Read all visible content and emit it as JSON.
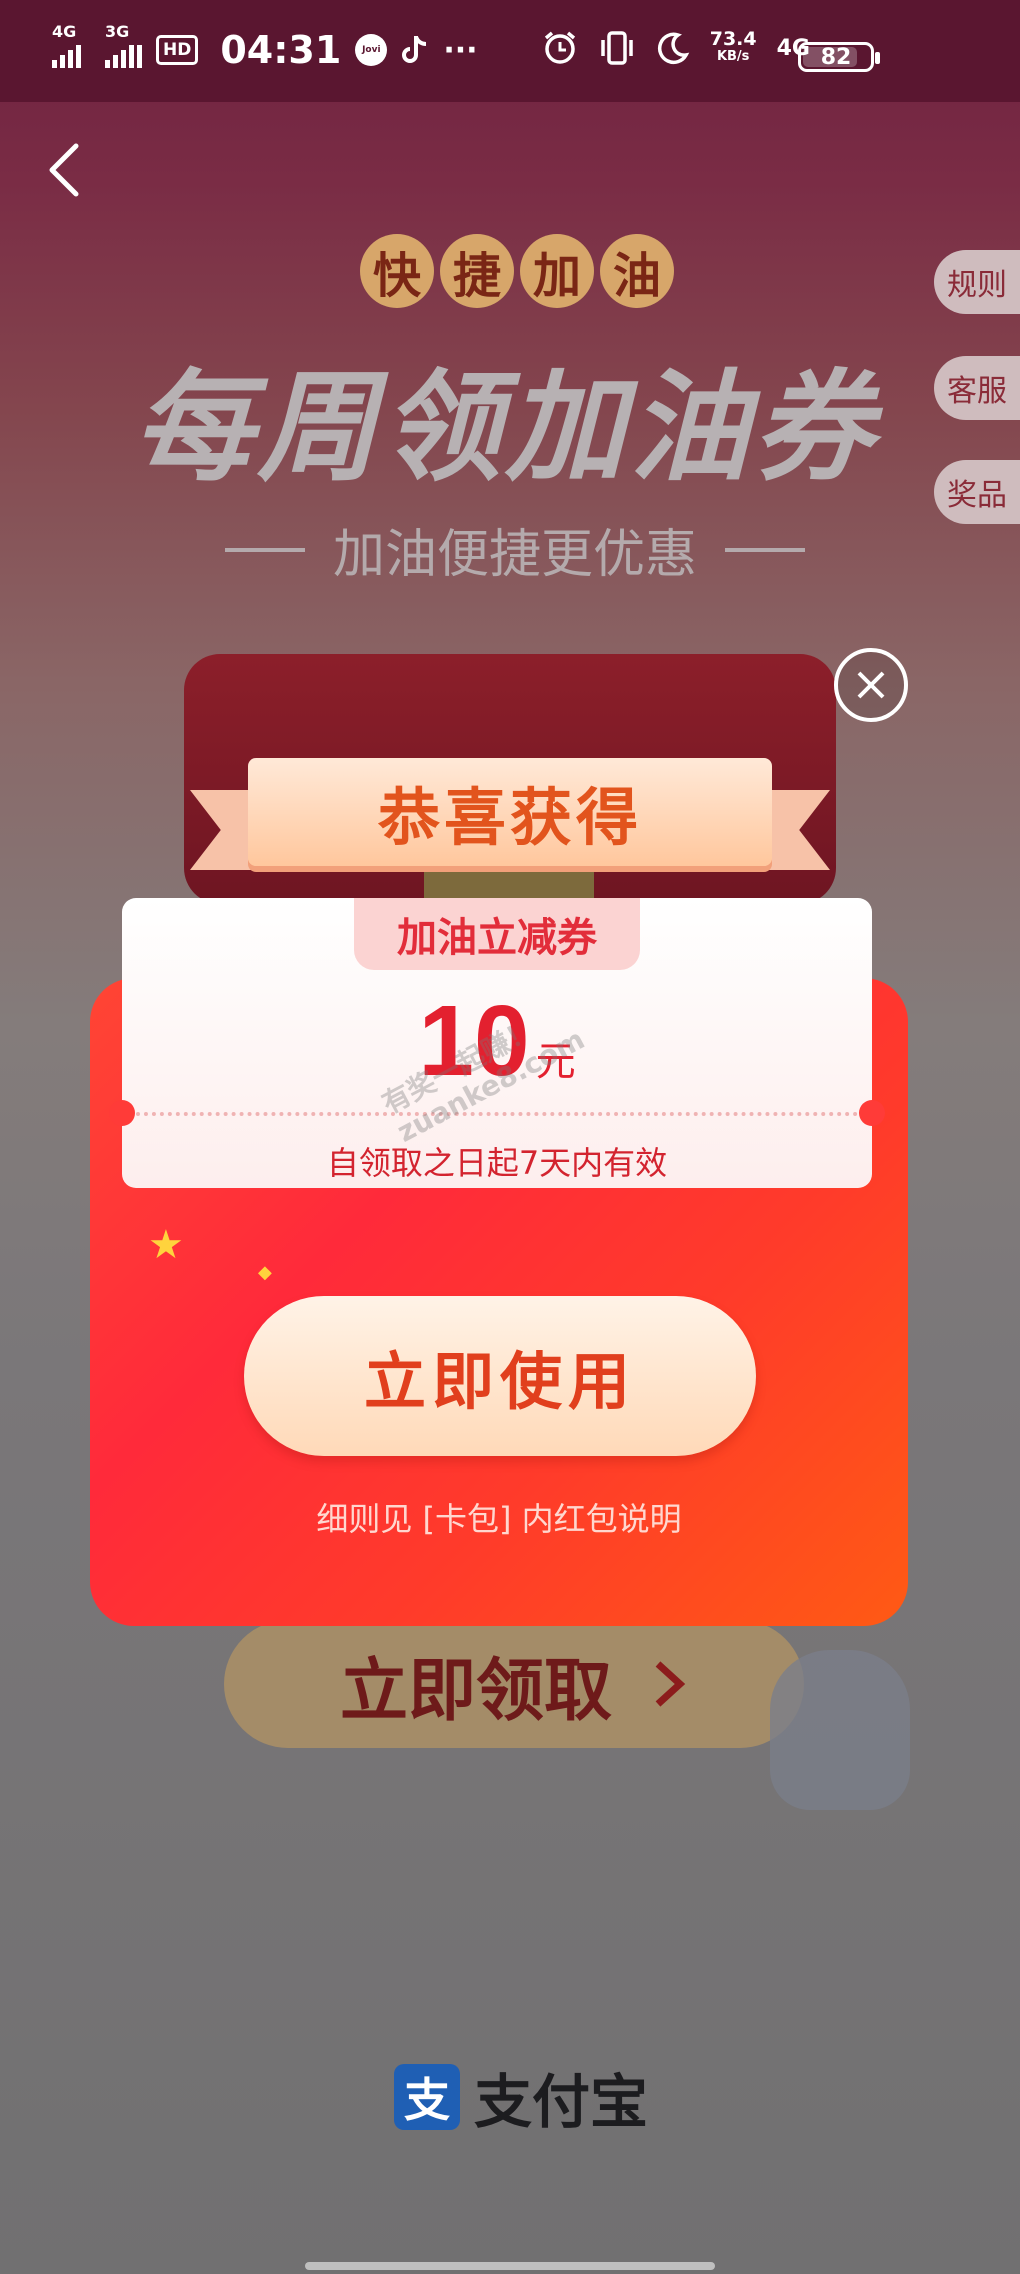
{
  "status_bar": {
    "sim1": "4G",
    "sim2": "3G",
    "hd": "HD",
    "time": "04:31",
    "jovi": "Jovi",
    "more": "···",
    "speed_value": "73.4",
    "speed_unit": "KB/s",
    "network": "4G",
    "battery": "82"
  },
  "header": {
    "badge_chars": [
      "快",
      "捷",
      "加",
      "油"
    ],
    "title": "每周领加油券",
    "subtitle": "加油便捷更优惠"
  },
  "side_buttons": [
    "规则",
    "客服",
    "奖品"
  ],
  "modal": {
    "ribbon": "恭喜获得",
    "coupon_type": "加油立减券",
    "amount": "10",
    "unit": "元",
    "validity": "自领取之日起7天内有效",
    "use_button": "立即使用",
    "note": "细则见 [卡包] 内红包说明"
  },
  "background_button": "立即领取",
  "watermark": [
    "有奖一起赚！",
    "zuanke8.com"
  ],
  "footer": {
    "brand": "支付宝",
    "logo_glyph": "支"
  },
  "colors": {
    "accent_red": "#ff2a3a",
    "coupon_text": "#e3202f",
    "button_text": "#e13f1d"
  }
}
